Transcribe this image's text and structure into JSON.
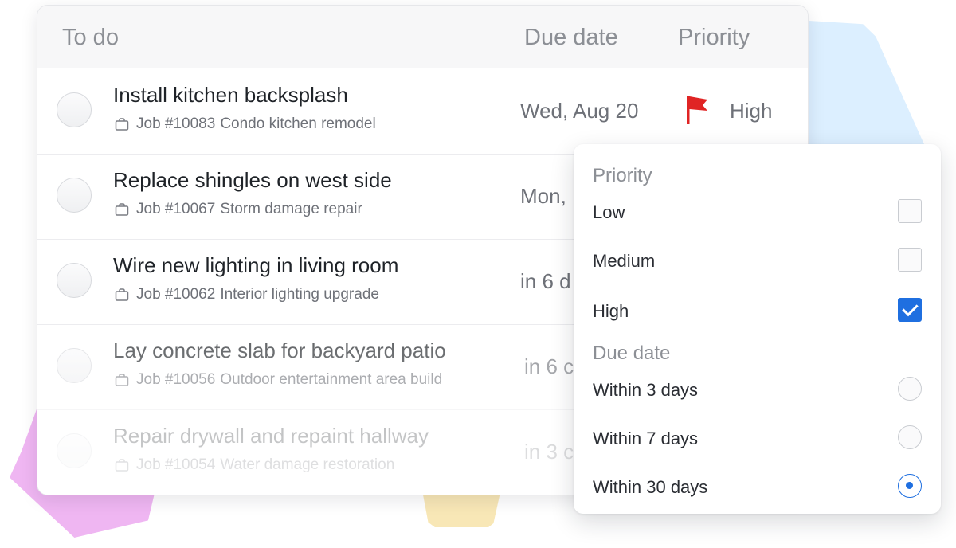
{
  "header": {
    "col_todo": "To do",
    "col_due": "Due date",
    "col_priority": "Priority"
  },
  "tasks": [
    {
      "title": "Install kitchen backsplash",
      "job_number": "Job #10083",
      "job_name": "Condo kitchen remodel",
      "due": "Wed, Aug 20",
      "priority": "High",
      "flag_color": "#e02424",
      "opacity": 1
    },
    {
      "title": "Replace shingles on west side",
      "job_number": "Job #10067",
      "job_name": "Storm damage repair",
      "due": "Mon,",
      "opacity": 1
    },
    {
      "title": "Wire new lighting in living room",
      "job_number": "Job #10062",
      "job_name": "Interior lighting upgrade",
      "due": "in 6 d",
      "opacity": 1
    },
    {
      "title": "Lay concrete slab for backyard patio",
      "job_number": "Job #10056",
      "job_name": "Outdoor entertainment area build",
      "due": "in 6 c",
      "opacity": 0.75
    },
    {
      "title": "Repair drywall and repaint hallway",
      "job_number": "Job #10054",
      "job_name": "Water damage restoration",
      "due": "in 3 c",
      "opacity": 0.45
    }
  ],
  "filter": {
    "priority_title": "Priority",
    "priority_options": [
      {
        "label": "Low",
        "checked": false
      },
      {
        "label": "Medium",
        "checked": false
      },
      {
        "label": "High",
        "checked": true
      }
    ],
    "due_title": "Due date",
    "due_options": [
      {
        "label": "Within 3 days",
        "selected": false
      },
      {
        "label": "Within 7 days",
        "selected": false
      },
      {
        "label": "Within 30 days",
        "selected": true
      }
    ]
  },
  "colors": {
    "accent": "#1f6fe0",
    "flag": "#e02424",
    "deco_blue": "#dcefff",
    "deco_pink": "#efb6f2",
    "deco_yellow": "#f8e7b6"
  }
}
